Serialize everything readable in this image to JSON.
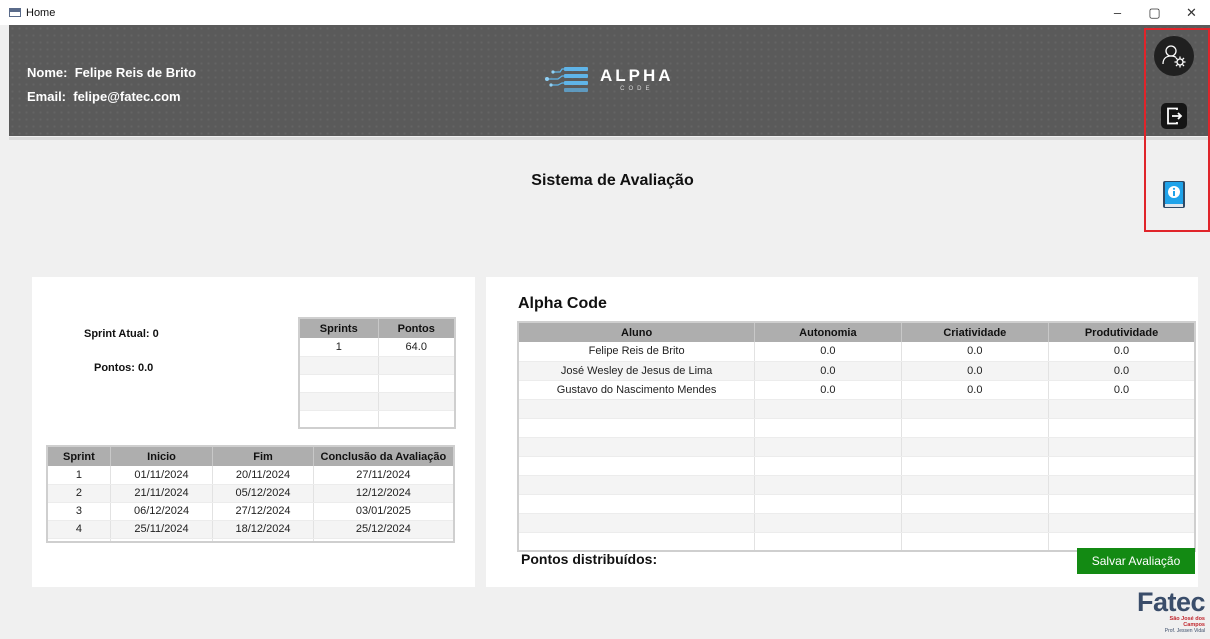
{
  "window": {
    "title": "Home",
    "minimize": "–",
    "maximize": "▢",
    "close": "✕"
  },
  "user": {
    "name_label": "Nome:",
    "name": "Felipe Reis de Brito",
    "email_label": "Email:",
    "email": "felipe@fatec.com"
  },
  "logo": {
    "title": "ALPHA",
    "subtitle": "CODE"
  },
  "page_title": "Sistema de Avaliação",
  "sprint_info": {
    "current": "Sprint Atual: 0",
    "points": "Pontos: 0.0"
  },
  "sprints_table": {
    "headers": [
      "Sprints",
      "Pontos"
    ],
    "rows": [
      [
        "1",
        "64.0"
      ],
      [
        "",
        ""
      ],
      [
        "",
        ""
      ],
      [
        "",
        ""
      ],
      [
        "",
        ""
      ]
    ]
  },
  "dates_table": {
    "headers": [
      "Sprint",
      "Inicio",
      "Fim",
      "Conclusão da Avaliação"
    ],
    "rows": [
      [
        "1",
        "01/11/2024",
        "20/11/2024",
        "27/11/2024"
      ],
      [
        "2",
        "21/11/2024",
        "05/12/2024",
        "12/12/2024"
      ],
      [
        "3",
        "06/12/2024",
        "27/12/2024",
        "03/01/2025"
      ],
      [
        "4",
        "25/11/2024",
        "18/12/2024",
        "25/12/2024"
      ],
      [
        "",
        "",
        "",
        ""
      ]
    ]
  },
  "team": {
    "name": "Alpha Code",
    "headers": [
      "Aluno",
      "Autonomia",
      "Criatividade",
      "Produtividade"
    ],
    "rows": [
      [
        "Felipe Reis de Brito",
        "0.0",
        "0.0",
        "0.0"
      ],
      [
        "José Wesley de Jesus de Lima",
        "0.0",
        "0.0",
        "0.0"
      ],
      [
        "Gustavo do Nascimento Mendes",
        "0.0",
        "0.0",
        "0.0"
      ],
      [
        "",
        "",
        "",
        ""
      ],
      [
        "",
        "",
        "",
        ""
      ],
      [
        "",
        "",
        "",
        ""
      ],
      [
        "",
        "",
        "",
        ""
      ],
      [
        "",
        "",
        "",
        ""
      ],
      [
        "",
        "",
        "",
        ""
      ],
      [
        "",
        "",
        "",
        ""
      ],
      [
        "",
        "",
        "",
        ""
      ]
    ]
  },
  "points_distributed_label": "Pontos distribuídos:",
  "save_button": "Salvar Avaliação",
  "footer_logo": {
    "name": "Fatec",
    "line1": "São José dos",
    "line2": "Campos",
    "line3": "Prof. Jessen Vidal"
  },
  "colors": {
    "header_bg": "#5a5a5a",
    "save_button": "#138a13",
    "highlight_border": "#e0242a",
    "fatec_blue": "#3a4d6a",
    "fatec_red": "#c0262d"
  },
  "icons": {
    "profile": "user-settings-icon",
    "logout": "logout-icon",
    "info": "info-book-icon"
  }
}
